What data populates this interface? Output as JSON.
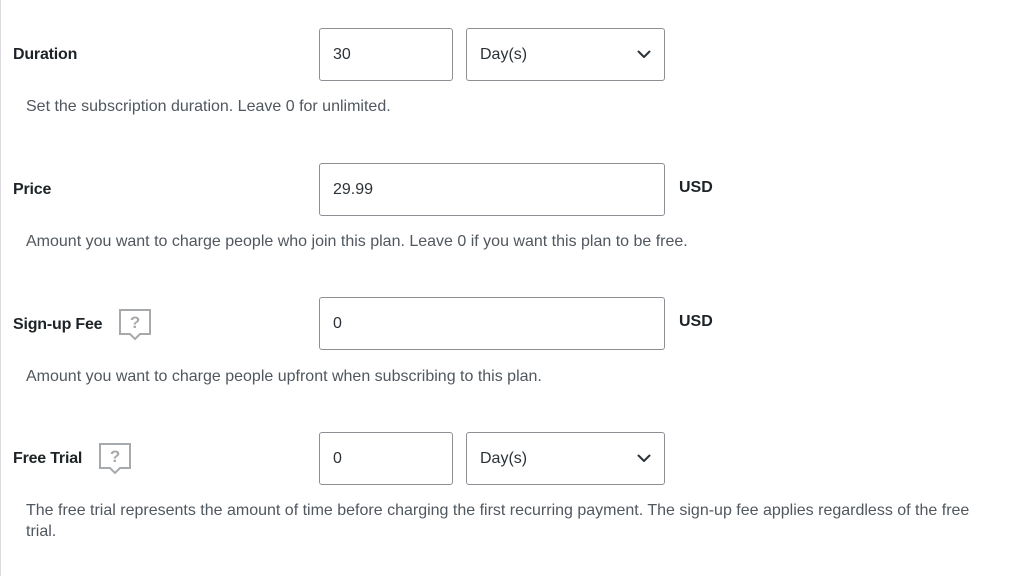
{
  "duration": {
    "label": "Duration",
    "value": "30",
    "unit": "Day(s)",
    "description": "Set the subscription duration. Leave 0 for unlimited."
  },
  "price": {
    "label": "Price",
    "value": "29.99",
    "currency": "USD",
    "description": "Amount you want to charge people who join this plan. Leave 0 if you want this plan to be free."
  },
  "signup_fee": {
    "label": "Sign-up Fee",
    "value": "0",
    "currency": "USD",
    "description": "Amount you want to charge people upfront when subscribing to this plan.",
    "help_icon": "help-speech-bubble-icon"
  },
  "free_trial": {
    "label": "Free Trial",
    "value": "0",
    "unit": "Day(s)",
    "description": "The free trial represents the amount of time before charging the first recurring payment. The sign-up fee applies regardless of the free trial.",
    "help_icon": "help-speech-bubble-icon"
  },
  "colors": {
    "label_text": "#1d2327",
    "description_text": "#50575e",
    "input_border": "#8c8f94",
    "icon_stroke": "#a7aaad"
  }
}
